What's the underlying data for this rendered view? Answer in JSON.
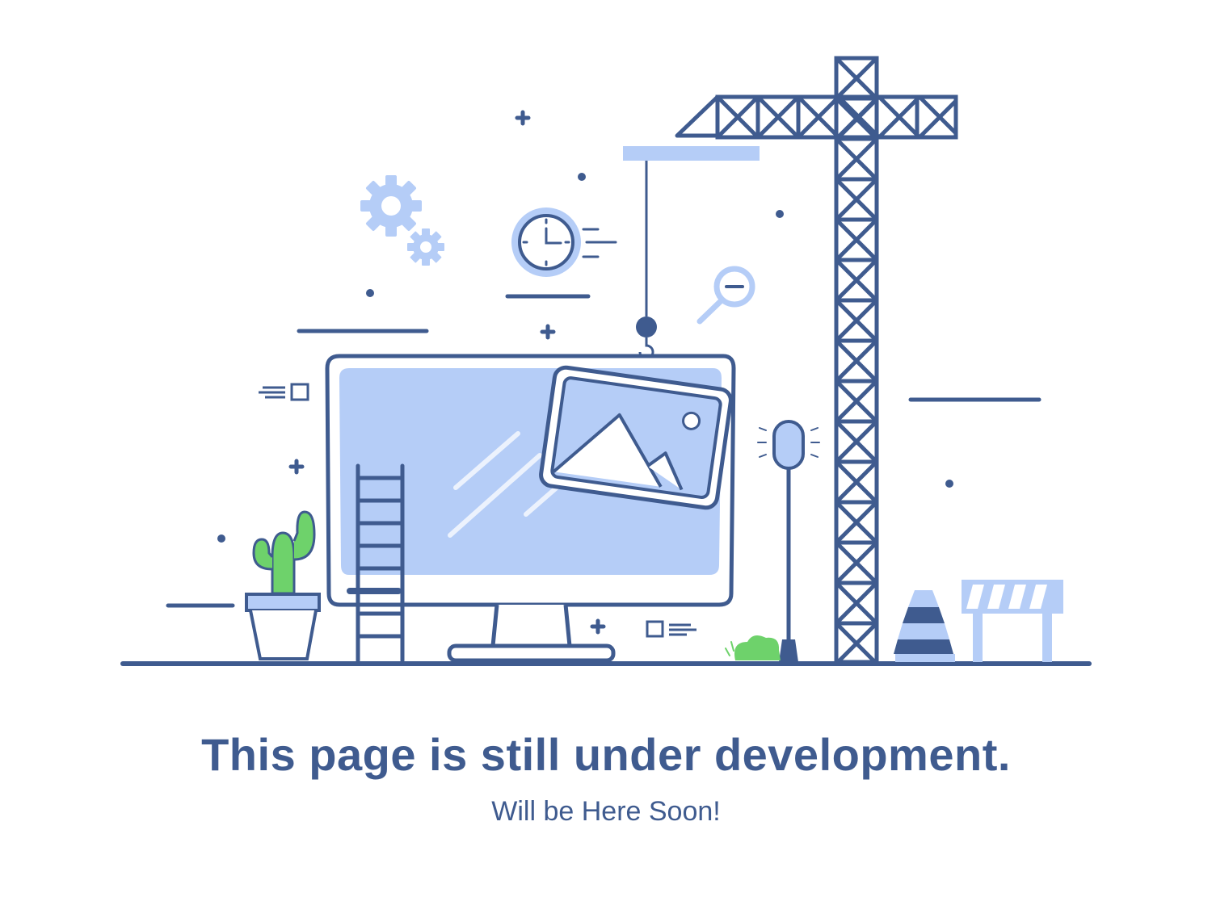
{
  "illustration": {
    "subject": "under-construction",
    "colors": {
      "primary": "#3f5b8f",
      "accent": "#b5cdf7",
      "plant": "#6ed26b",
      "background": "#ffffff"
    }
  },
  "message": {
    "headline": "This page is still under development.",
    "subline": "Will be Here Soon!"
  }
}
